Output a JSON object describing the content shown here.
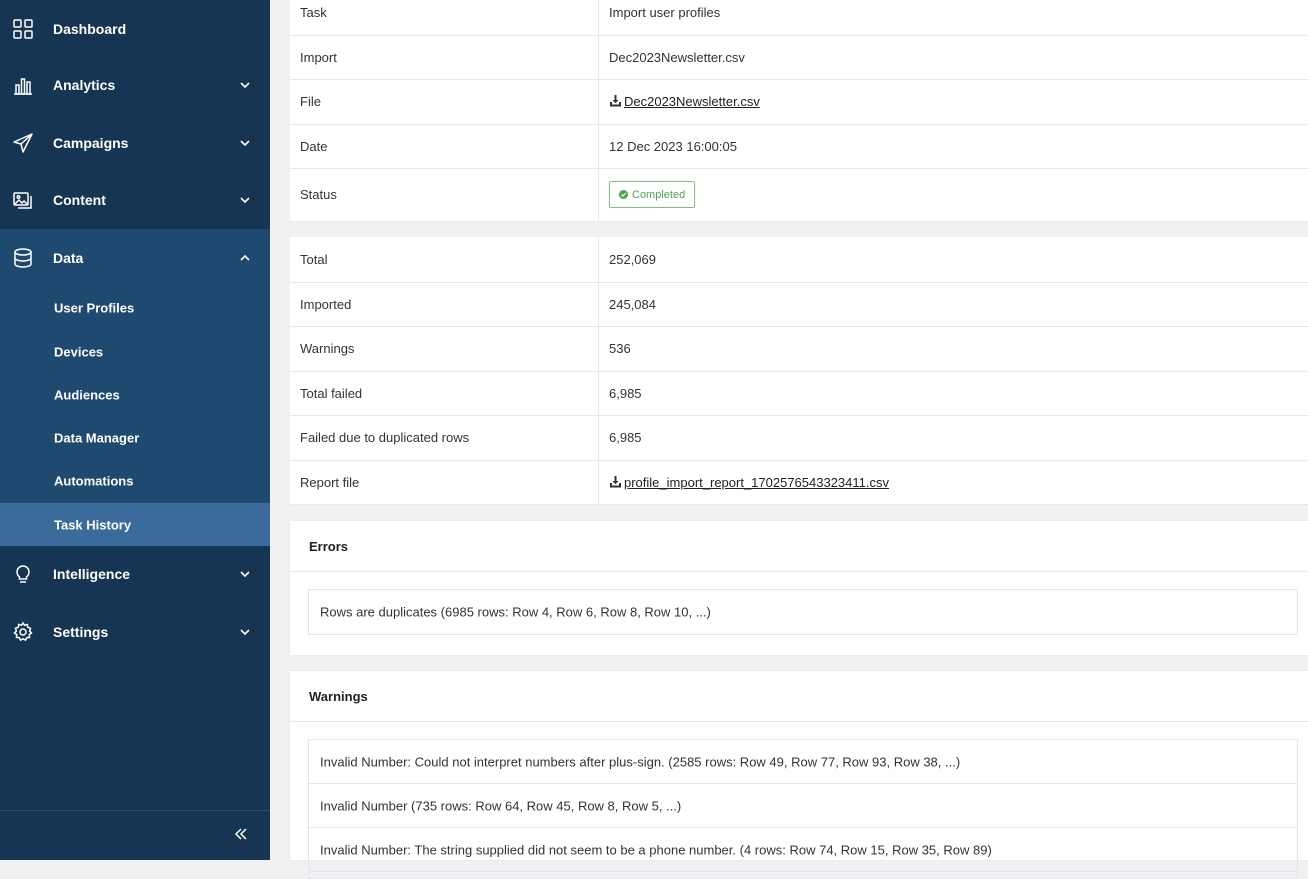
{
  "sidebar": {
    "items": [
      {
        "label": "Dashboard",
        "icon": "grid-icon"
      },
      {
        "label": "Analytics",
        "icon": "bar-chart-icon"
      },
      {
        "label": "Campaigns",
        "icon": "paper-plane-icon"
      },
      {
        "label": "Content",
        "icon": "images-icon"
      },
      {
        "label": "Data",
        "icon": "database-icon"
      },
      {
        "label": "Intelligence",
        "icon": "lightbulb-icon"
      },
      {
        "label": "Settings",
        "icon": "gear-icon"
      }
    ],
    "data_sub_items": [
      "User Profiles",
      "Devices",
      "Audiences",
      "Data Manager",
      "Automations",
      "Task History"
    ],
    "active_sub_item": "Task History"
  },
  "task_details": {
    "rows": [
      {
        "key": "Task",
        "value": "Import user profiles"
      },
      {
        "key": "Import",
        "value": "Dec2023Newsletter.csv"
      },
      {
        "key": "File",
        "value": "Dec2023Newsletter.csv"
      },
      {
        "key": "Date",
        "value": "12 Dec 2023 16:00:05"
      },
      {
        "key": "Status",
        "value": "Completed"
      }
    ]
  },
  "stats": {
    "rows": [
      {
        "key": "Total",
        "value": "252,069"
      },
      {
        "key": "Imported",
        "value": "245,084"
      },
      {
        "key": "Warnings",
        "value": "536"
      },
      {
        "key": "Total failed",
        "value": "6,985"
      },
      {
        "key": "Failed due to duplicated rows",
        "value": "6,985"
      },
      {
        "key": "Report file",
        "value": "profile_import_report_1702576543323411.csv"
      }
    ]
  },
  "errors": {
    "title": "Errors",
    "items": [
      "Rows are duplicates (6985 rows: Row 4, Row 6, Row 8, Row 10, ...)"
    ]
  },
  "warnings": {
    "title": "Warnings",
    "items": [
      "Invalid Number: Could not interpret numbers after plus-sign. (2585 rows: Row 49, Row 77, Row 93, Row 38, ...)",
      "Invalid Number (735 rows: Row 64, Row 45, Row 8, Row 5, ...)",
      "Invalid Number: The string supplied did not seem to be a phone number. (4 rows: Row 74, Row 15, Row 35, Row 89)"
    ]
  },
  "colors": {
    "sidebar_bg": "#163553",
    "sidebar_group_bg": "#1e4a70",
    "active_item_bg": "#3a6b9b",
    "status_green": "#4aa84f"
  }
}
